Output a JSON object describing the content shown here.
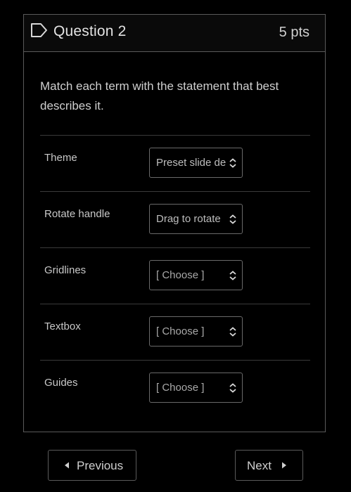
{
  "question": {
    "title": "Question 2",
    "points": "5 pts",
    "prompt": "Match each term with the statement that best describes it."
  },
  "matches": [
    {
      "term": "Theme",
      "selected": "Preset slide de",
      "placeholder": false
    },
    {
      "term": "Rotate handle",
      "selected": "Drag to rotate",
      "placeholder": false
    },
    {
      "term": "Gridlines",
      "selected": "[ Choose ]",
      "placeholder": true
    },
    {
      "term": "Textbox",
      "selected": "[ Choose ]",
      "placeholder": true
    },
    {
      "term": "Guides",
      "selected": "[ Choose ]",
      "placeholder": true
    }
  ],
  "navigation": {
    "previous_label": "Previous",
    "next_label": "Next"
  },
  "icons": {
    "flag": "bookmark-flag-icon",
    "select_arrows": "up-down-chevron-icon",
    "previous_arrow": "triangle-left-icon",
    "next_arrow": "triangle-right-icon"
  },
  "colors": {
    "background": "#000000",
    "border": "#5a5a5a",
    "text": "#cfcfcf"
  }
}
